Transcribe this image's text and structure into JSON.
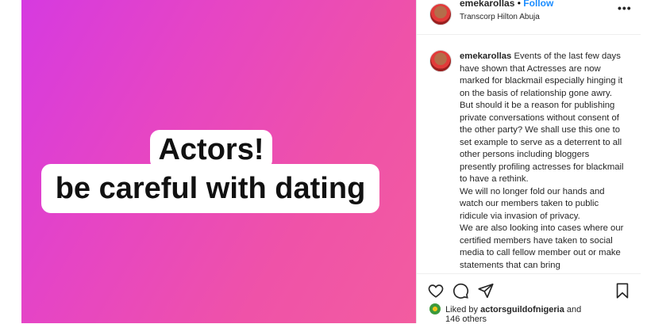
{
  "post": {
    "caption_line1": "Actors!",
    "caption_line2": "be careful with dating",
    "gradient_colors": [
      "#d63ae0",
      "#f35ca0"
    ]
  },
  "header": {
    "username": "emekarollas",
    "separator": "•",
    "follow_label": "Follow",
    "location": "Transcorp Hilton Abuja",
    "more_icon": "more-horizontal-icon",
    "more_label": "•••"
  },
  "comment": {
    "username": "emekarollas",
    "paragraph1": "Events of the last few days have shown that Actresses are now marked for blackmail especially hinging it on the basis of relationship gone awry. But should it be a reason for publishing private conversations without consent of the other party? We shall use this one to set example to serve as a deterrent to all other persons including bloggers presently profiling actresses for blackmail to have a rethink.",
    "paragraph2": "We will no longer fold our hands and watch our members taken to public ridicule via invasion of privacy.",
    "paragraph3": "We are also looking into cases where our certified members have taken to social media to call fellow member out or make statements that can bring"
  },
  "actions": {
    "heart_icon": "heart-icon",
    "comment_icon": "comment-icon",
    "share_icon": "share-icon",
    "bookmark_icon": "bookmark-icon"
  },
  "likes": {
    "prefix": "Liked by",
    "username": "actorsguildofnigeria",
    "suffix": "and",
    "others": "146 others"
  },
  "colors": {
    "accent": "#1a8cff",
    "text": "#262626"
  }
}
